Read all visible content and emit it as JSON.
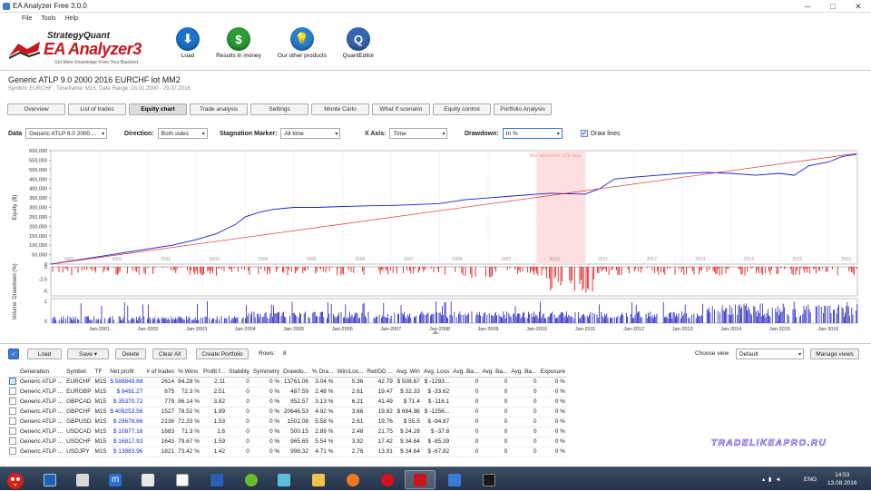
{
  "window": {
    "title": "EA Analyzer Free 3.0.0"
  },
  "menu": [
    "File",
    "Tools",
    "Help"
  ],
  "logo": {
    "line1": "StrategyQuant",
    "line2": "EA Analyzer3",
    "tagline": "Get More Knowledge From Your Backtest"
  },
  "toolbar": {
    "buttons": [
      {
        "label": "Load",
        "icon": "download-icon",
        "color": "#1e73c8"
      },
      {
        "label": "Results in money",
        "icon": "dollar-icon",
        "color": "#2a9d36"
      },
      {
        "label": "Our other products",
        "icon": "lightbulb-icon",
        "color": "#2a7fd0"
      },
      {
        "label": "QuantEditor",
        "icon": "quanteditor-icon",
        "color": "#3567b0"
      }
    ]
  },
  "header": {
    "title": "Generic ATLP 9.0 2000 2016 EURCHF lot MM2",
    "subtitle": "Symbol: EURCHF , Timeframe: M15, Date Range: 03.01.2000 - 29.07.2016"
  },
  "tabs": [
    "Overview",
    "List of trades",
    "Equity chart",
    "Trade analysis",
    "Settings",
    "Monte Carlo",
    "What If scenario",
    "Equity control",
    "Portfolio Analysis"
  ],
  "active_tab": "Equity chart",
  "controls": {
    "data_label": "Data",
    "data_value": "Generic ATLP 9.0 2000 ...",
    "direction_label": "Direction:",
    "direction_value": "Both sides",
    "stagnation_label": "Stagnation Marker:",
    "stagnation_value": "All time",
    "xaxis_label": "X Axis:",
    "xaxis_value": "Time",
    "drawdown_label": "Drawdown:",
    "drawdown_value": "In %",
    "drawlines_label": "Draw lines",
    "drawlines_checked": true
  },
  "chart_data": [
    {
      "type": "line",
      "ylabel": "Equity ($)",
      "ylim": [
        0,
        600000
      ],
      "yticks": [
        "600,000",
        "550,000",
        "500,000",
        "450,000",
        "400,000",
        "350,000",
        "300,000",
        "250,000",
        "200,000",
        "150,000",
        "100,000",
        "50,000",
        "0"
      ],
      "year_labels": [
        "2000",
        "2001",
        "2002",
        "2003",
        "2004",
        "2005",
        "2006",
        "2007",
        "2008",
        "2009",
        "2010",
        "2011",
        "2012",
        "2013",
        "2014",
        "2015",
        "2016"
      ],
      "stagnation_label": "Max stagnation: 376 days",
      "series": [
        {
          "color": "#1a1ad0",
          "x": [
            2000.0,
            2000.5,
            2001.0,
            2001.5,
            2002.0,
            2002.5,
            2003.0,
            2003.4,
            2003.8,
            2004.0,
            2004.3,
            2004.6,
            2005.0,
            2005.5,
            2006.0,
            2006.5,
            2007.0,
            2007.5,
            2008.0,
            2008.5,
            2009.0,
            2009.5,
            2010.0,
            2010.3,
            2010.6,
            2011.0,
            2011.3,
            2011.6,
            2012.0,
            2012.5,
            2013.0,
            2013.5,
            2014.0,
            2014.5,
            2015.0,
            2015.3,
            2015.6,
            2016.0,
            2016.3,
            2016.58
          ],
          "y": [
            0,
            20000,
            40000,
            60000,
            80000,
            100000,
            130000,
            160000,
            210000,
            250000,
            275000,
            290000,
            300000,
            300000,
            305000,
            308000,
            310000,
            315000,
            320000,
            340000,
            350000,
            360000,
            370000,
            375000,
            372000,
            370000,
            400000,
            450000,
            460000,
            470000,
            480000,
            485000,
            480000,
            470000,
            480000,
            470000,
            520000,
            540000,
            570000,
            580000
          ]
        },
        {
          "color": "#e03030",
          "x": [
            2000.0,
            2016.58
          ],
          "y": [
            0,
            585000
          ]
        }
      ]
    },
    {
      "type": "bar",
      "ylabel": "Drawdown (%)",
      "ylim": [
        -6,
        0
      ],
      "yticks": [
        "0",
        "-2.5",
        "-5"
      ],
      "color": "#e02020"
    },
    {
      "type": "bar",
      "ylabel": "Volume",
      "yticks": [
        "1",
        "0"
      ],
      "color": "#2020c0",
      "x_labels": [
        "Jan-2001",
        "Jan-2002",
        "Jan-2003",
        "Jan-2004",
        "Jan-2005",
        "Jan-2006",
        "Jan-2007",
        "Jan-2008",
        "Jan-2009",
        "Jan-2010",
        "Jan-2011",
        "Jan-2012",
        "Jan-2013",
        "Jan-2014",
        "Jan-2015",
        "Jan-2016"
      ]
    }
  ],
  "bottom": {
    "load": "Load",
    "save": "Save",
    "delete": "Delete",
    "clear_all": "Clear All",
    "create_portfolio": "Create Portfolio",
    "rows_label": "Rows:",
    "rows_value": "8",
    "choose_view_label": "Choose view",
    "choose_view_value": "Default",
    "manage_views": "Manage views"
  },
  "table": {
    "columns": [
      "Generation",
      "Symbol",
      "TF",
      "Net profit",
      "# of trades",
      "% Wins",
      "Profit f...",
      "Stability",
      "Symmetry",
      "Drawdo...",
      "% Dra...",
      "Win/Los...",
      "Ret/DD ...",
      "Avg. Win",
      "Avg. Loss",
      "Avg. Ba...",
      "Avg. Ba...",
      "Avg. Ba...",
      "Exposure"
    ],
    "rows": [
      [
        "Generic ATLP ...",
        "EURCHF",
        "M15",
        "$ 588849.88",
        "2614",
        "84.28 %",
        "2.11",
        "0",
        "0 %",
        "13761.06",
        "3.04 %",
        "5.36",
        "42.79",
        "$ 508.67",
        "$ -1293...",
        "0",
        "0",
        "0",
        "0 %"
      ],
      [
        "Generic ATLP ...",
        "EURGBP",
        "M15",
        "$ 9491.27",
        "675",
        "72.3 %",
        "2.51",
        "0",
        "0 %",
        "487.59",
        "2.48 %",
        "2.61",
        "19.47",
        "$ 32.33",
        "$ -33.62",
        "0",
        "0",
        "0",
        "0 %"
      ],
      [
        "Generic ATLP ...",
        "GBPCAD",
        "M15",
        "$ 35370.72",
        "779",
        "86.14 %",
        "3.82",
        "0",
        "0 %",
        "852.57",
        "3.13 %",
        "6.21",
        "41.49",
        "$ 71.4",
        "$ -116.1",
        "0",
        "0",
        "0",
        "0 %"
      ],
      [
        "Generic ATLP ...",
        "GBPCHF",
        "M15",
        "$ 409253.56",
        "1527",
        "78.52 %",
        "1.99",
        "0",
        "0 %",
        "20646.53",
        "4.92 %",
        "3.66",
        "19.82",
        "$ 684.98",
        "$ -1256...",
        "0",
        "0",
        "0",
        "0 %"
      ],
      [
        "Generic ATLP ...",
        "GBPUSD",
        "M15",
        "$ 29678.66",
        "2136",
        "72.33 %",
        "1.53",
        "0",
        "0 %",
        "1502.08",
        "5.58 %",
        "2.61",
        "19.76",
        "$ 55.5",
        "$ -94.87",
        "0",
        "0",
        "0",
        "0 %"
      ],
      [
        "Generic ATLP ...",
        "USDCAD",
        "M15",
        "$ 10877.16",
        "1683",
        "71.3 %",
        "1.6",
        "0",
        "0 %",
        "500.15",
        "2.89 %",
        "2.48",
        "21.75",
        "$ 24.28",
        "$ -37.8",
        "0",
        "0",
        "0",
        "0 %"
      ],
      [
        "Generic ATLP ...",
        "USDCHF",
        "M15",
        "$ 16817.93",
        "1643",
        "79.67 %",
        "1.59",
        "0",
        "0 %",
        "965.65",
        "5.54 %",
        "3.92",
        "17.42",
        "$ 34.64",
        "$ -85.39",
        "0",
        "0",
        "0",
        "0 %"
      ],
      [
        "Generic ATLP ...",
        "USDJPY",
        "M15",
        "$ 13883.96",
        "1821",
        "73.42 %",
        "1.42",
        "0",
        "0 %",
        "998.32",
        "4.71 %",
        "2.76",
        "13.91",
        "$ 34.64",
        "$ -67.82",
        "0",
        "0",
        "0",
        "0 %"
      ]
    ]
  },
  "watermark": "TRADELIKEAPRO.RU",
  "taskbar": {
    "lang": "ENG",
    "time": "14:53",
    "date": "13.08.2016"
  }
}
